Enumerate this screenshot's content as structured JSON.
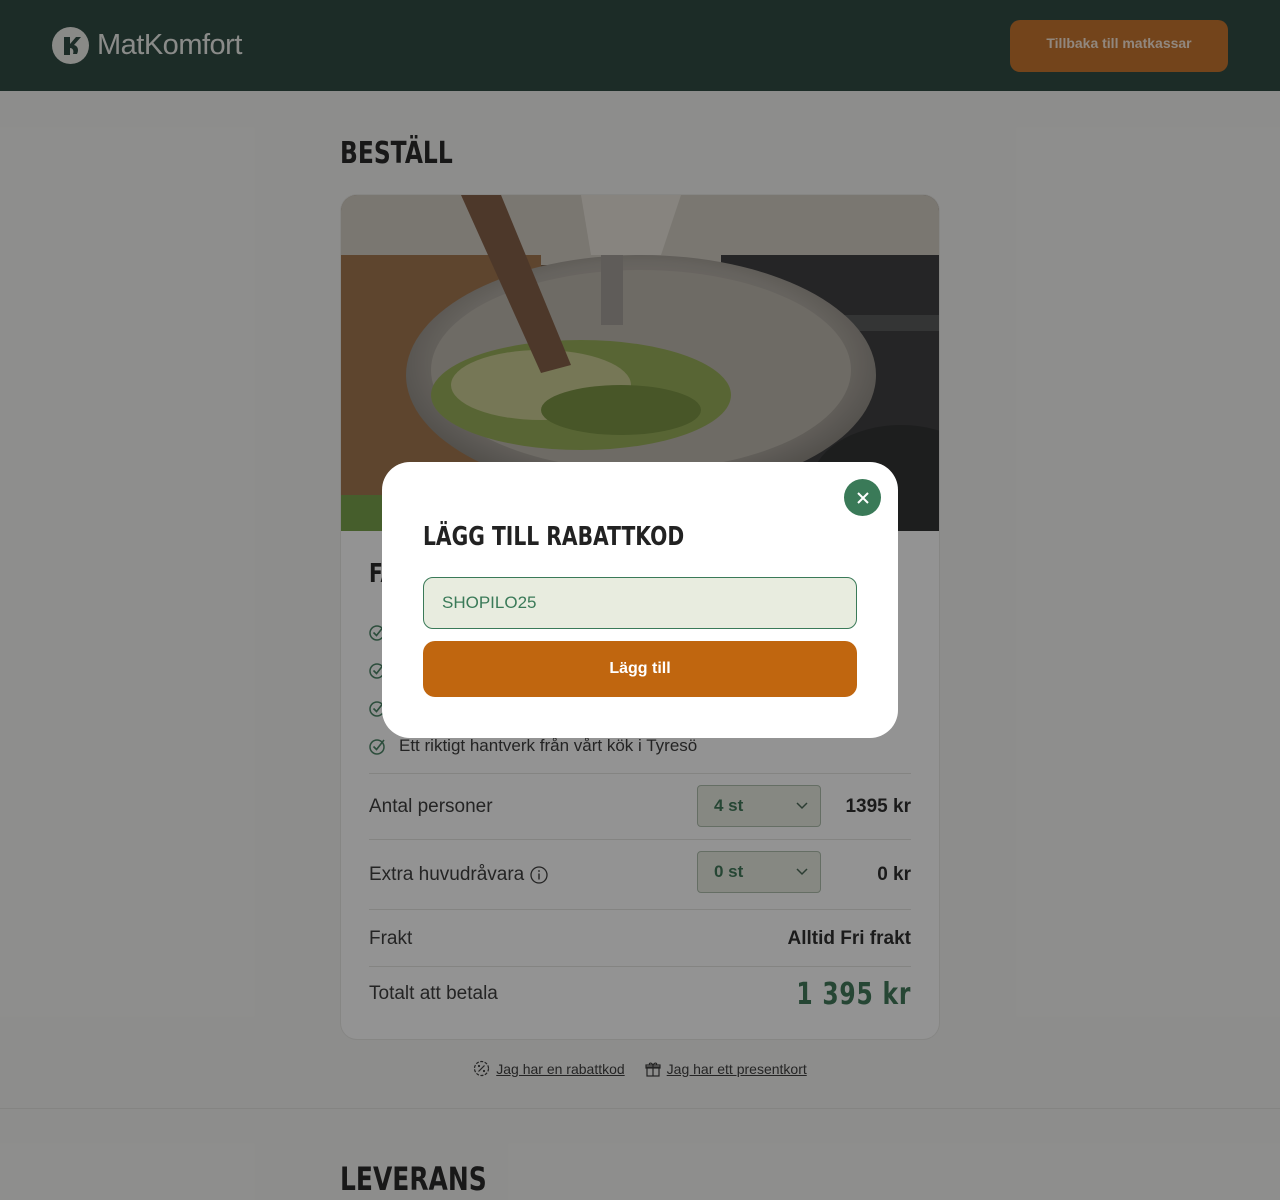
{
  "header": {
    "brand": "MatKomfort",
    "back_button": "Tillbaka till matkassar"
  },
  "order": {
    "title": "BESTÄLL",
    "card_heading": "FA",
    "features": [
      "",
      "",
      "",
      "Ett riktigt hantverk från vårt kök i Tyresö"
    ],
    "rows": {
      "persons": {
        "label": "Antal personer",
        "select": "4 st",
        "price": "1395 kr"
      },
      "extra": {
        "label": "Extra huvudråvara",
        "select": "0 st",
        "price": "0 kr"
      },
      "shipping": {
        "label": "Frakt",
        "value": "Alltid Fri frakt"
      },
      "total": {
        "label": "Totalt att betala",
        "value": "1 395 kr"
      }
    },
    "links": {
      "discount": "Jag har en rabattkod",
      "giftcard": "Jag har ett presentkort"
    }
  },
  "delivery": {
    "title": "LEVERANS"
  },
  "modal": {
    "title": "LÄGG TILL RABATTKOD",
    "input_value": "SHOPILO25",
    "submit": "Lägg till"
  },
  "colors": {
    "header_bg": "#1c3a31",
    "accent_orange": "#c0660f",
    "accent_green": "#3a7a58"
  }
}
